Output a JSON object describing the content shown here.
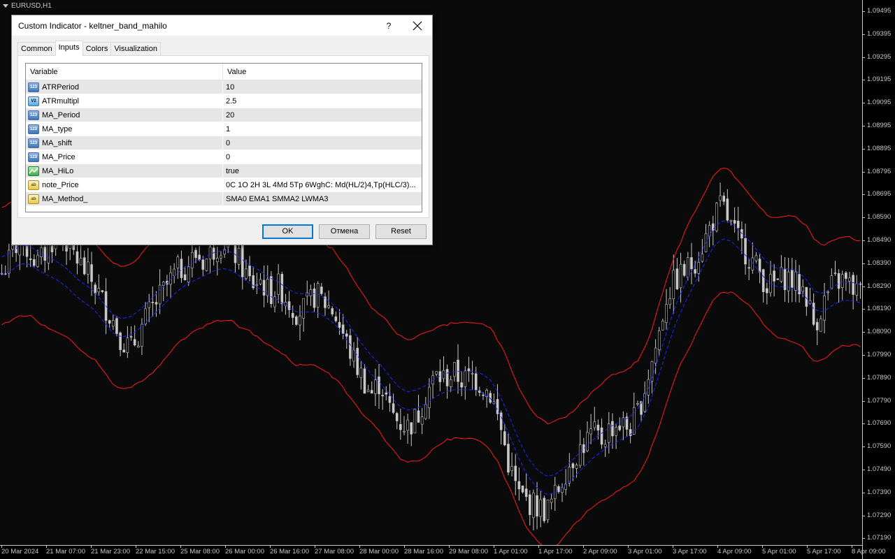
{
  "chart": {
    "symbol": "EURUSD,H1",
    "colors": {
      "background": "#0a0a0a",
      "candle": "#c8c8c8",
      "band_outer": "#ff1a1a",
      "band_inner": "#1a2cff"
    },
    "price_labels": [
      "1.09495",
      "1.09395",
      "1.09295",
      "1.09195",
      "1.09095",
      "1.08995",
      "1.08895",
      "1.08795",
      "1.08695",
      "1.08590",
      "1.08490",
      "1.08390",
      "1.08290",
      "1.08190",
      "1.08090",
      "1.07990",
      "1.07890",
      "1.07790",
      "1.07690",
      "1.07590",
      "1.07490",
      "1.07390",
      "1.07290",
      "1.07190"
    ],
    "time_labels": [
      "20 Mar 2024",
      "21 Mar 07:00",
      "21 Mar 23:00",
      "22 Mar 15:00",
      "25 Mar 08:00",
      "26 Mar 00:00",
      "26 Mar 16:00",
      "27 Mar 08:00",
      "28 Mar 00:00",
      "28 Mar 16:00",
      "29 Mar 08:00",
      "1 Apr 01:00",
      "1 Apr 17:00",
      "2 Apr 09:00",
      "3 Apr 01:00",
      "3 Apr 17:00",
      "4 Apr 09:00",
      "5 Apr 01:00",
      "5 Apr 17:00",
      "8 Apr 09:00"
    ],
    "price_series": [
      1.0835,
      1.0842,
      1.0851,
      1.0844,
      1.0839,
      1.0846,
      1.0853,
      1.0849,
      1.0842,
      1.0836,
      1.083,
      1.0822,
      1.0815,
      1.0806,
      1.0802,
      1.081,
      1.0818,
      1.0824,
      1.083,
      1.0836,
      1.0838,
      1.0843,
      1.084,
      1.0846,
      1.0849,
      1.0845,
      1.0838,
      1.083,
      1.0832,
      1.0826,
      1.0829,
      1.0823,
      1.0818,
      1.082,
      1.0826,
      1.0822,
      1.0818,
      1.0808,
      1.0798,
      1.079,
      1.0782,
      1.0788,
      1.0775,
      1.077,
      1.0768,
      1.0772,
      1.0783,
      1.079,
      1.0789,
      1.0791,
      1.0788,
      1.079,
      1.0786,
      1.0782,
      1.0768,
      1.075,
      1.0738,
      1.0735,
      1.0733,
      1.0731,
      1.0738,
      1.0748,
      1.0755,
      1.076,
      1.0765,
      1.0762,
      1.0768,
      1.0769,
      1.0767,
      1.0775,
      1.079,
      1.0805,
      1.0825,
      1.0832,
      1.0836,
      1.084,
      1.0848,
      1.0858,
      1.0865,
      1.0855,
      1.0848,
      1.0842,
      1.0836,
      1.0829,
      1.0831,
      1.0834,
      1.083,
      1.0828,
      1.0812,
      1.0822,
      1.083,
      1.0832,
      1.0829,
      1.0826
    ],
    "ma_series": [
      1.0838,
      1.084,
      1.0843,
      1.0843,
      1.084,
      1.0838,
      1.0836,
      1.0833,
      1.0829,
      1.0826,
      1.0823,
      1.0818,
      1.0813,
      1.0811,
      1.0812,
      1.0815,
      1.0819,
      1.0823,
      1.0827,
      1.0831,
      1.0834,
      1.0836,
      1.0838,
      1.084,
      1.0841,
      1.084,
      1.0837,
      1.0834,
      1.0832,
      1.0829,
      1.0827,
      1.0824,
      1.0822,
      1.0822,
      1.0822,
      1.082,
      1.0817,
      1.0812,
      1.0806,
      1.08,
      1.0795,
      1.0791,
      1.0786,
      1.0781,
      1.0779,
      1.078,
      1.0782,
      1.0785,
      1.0787,
      1.0788,
      1.0788,
      1.0788,
      1.0787,
      1.0784,
      1.0777,
      1.0768,
      1.0758,
      1.075,
      1.0745,
      1.0742,
      1.0743,
      1.0746,
      1.075,
      1.0754,
      1.0758,
      1.0761,
      1.0764,
      1.0766,
      1.0768,
      1.0772,
      1.078,
      1.0792,
      1.0805,
      1.0817,
      1.0826,
      1.0834,
      1.0842,
      1.085,
      1.0854,
      1.0853,
      1.0849,
      1.0845,
      1.084,
      1.0835,
      1.0833,
      1.0833,
      1.0832,
      1.0829,
      1.0823,
      1.0822,
      1.0825,
      1.0827,
      1.0827,
      1.0826
    ]
  },
  "dialog": {
    "title": "Custom Indicator - keltner_band_mahilo",
    "help_label": "?",
    "tabs": [
      "Common",
      "Inputs",
      "Colors",
      "Visualization"
    ],
    "active_tab": "Inputs",
    "columns": {
      "variable": "Variable",
      "value": "Value"
    },
    "rows": [
      {
        "icon": "int-type-icon",
        "type_glyph": "123",
        "variable": "ATRPeriod",
        "value": "10"
      },
      {
        "icon": "double-type-icon",
        "type_glyph": "V2",
        "variable": "ATRmultipl",
        "value": "2.5"
      },
      {
        "icon": "int-type-icon",
        "type_glyph": "123",
        "variable": "MA_Period",
        "value": "20"
      },
      {
        "icon": "int-type-icon",
        "type_glyph": "123",
        "variable": "MA_type",
        "value": "1"
      },
      {
        "icon": "int-type-icon",
        "type_glyph": "123",
        "variable": "MA_shift",
        "value": "0"
      },
      {
        "icon": "int-type-icon",
        "type_glyph": "123",
        "variable": "MA_Price",
        "value": "0"
      },
      {
        "icon": "bool-type-icon",
        "type_glyph": "",
        "variable": "MA_HiLo",
        "value": "true"
      },
      {
        "icon": "string-type-icon",
        "type_glyph": "ab",
        "variable": "note_Price",
        "value": "0C 1O 2H 3L 4Md 5Tp 6WghC: Md(HL/2)4,Tp(HLC/3)..."
      },
      {
        "icon": "string-type-icon",
        "type_glyph": "ab",
        "variable": "MA_Method_",
        "value": "SMA0 EMA1 SMMA2 LWMA3"
      }
    ],
    "buttons": {
      "ok": "OK",
      "cancel": "Отмена",
      "reset": "Reset"
    }
  }
}
